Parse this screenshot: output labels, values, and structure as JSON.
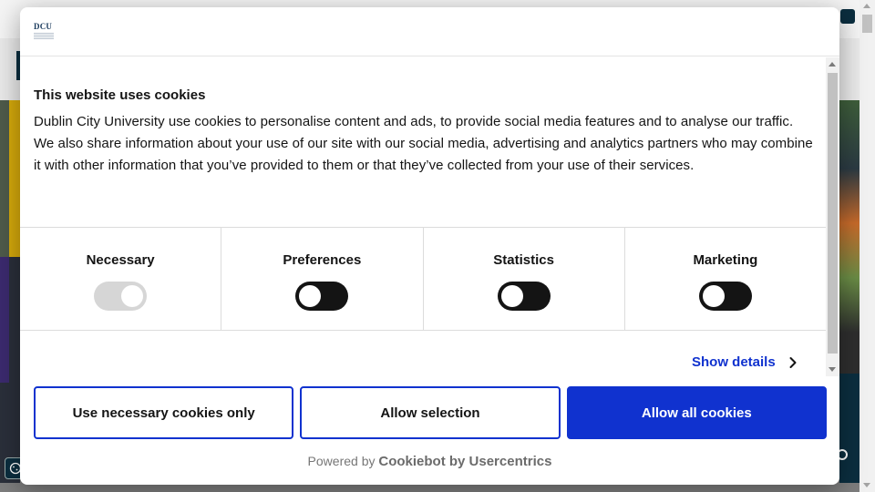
{
  "dialog": {
    "logo_text": "DCU",
    "title": "This website uses cookies",
    "body": "Dublin City University use cookies to personalise content and ads, to provide social media features and to analyse our traffic. We also share information about your use of our site with our social media, advertising and analytics partners who may combine it with other information that you’ve provided to them or that they’ve collected from your use of their services.",
    "categories": [
      {
        "label": "Necessary",
        "enabled": true,
        "locked": true
      },
      {
        "label": "Preferences",
        "enabled": false,
        "locked": false
      },
      {
        "label": "Statistics",
        "enabled": false,
        "locked": false
      },
      {
        "label": "Marketing",
        "enabled": false,
        "locked": false
      }
    ],
    "show_details_label": "Show details",
    "buttons": {
      "necessary_only": "Use necessary cookies only",
      "allow_selection": "Allow selection",
      "allow_all": "Allow all cookies"
    },
    "powered_by_prefix": "Powered by",
    "powered_by_brand": "Cookiebot by Usercentrics"
  },
  "colors": {
    "accent": "#1032cf",
    "toggle_off": "#141414",
    "toggle_disabled": "#d6d6d6",
    "overlay": "#7d7d7d",
    "site_navy": "#0b2e3f",
    "site_yellow": "#d5a90b"
  },
  "icons": {
    "show_details": "chevron-right-icon",
    "cookie_widget": "cookie-icon",
    "phone": "phone-icon",
    "chat": "chat-icon"
  }
}
